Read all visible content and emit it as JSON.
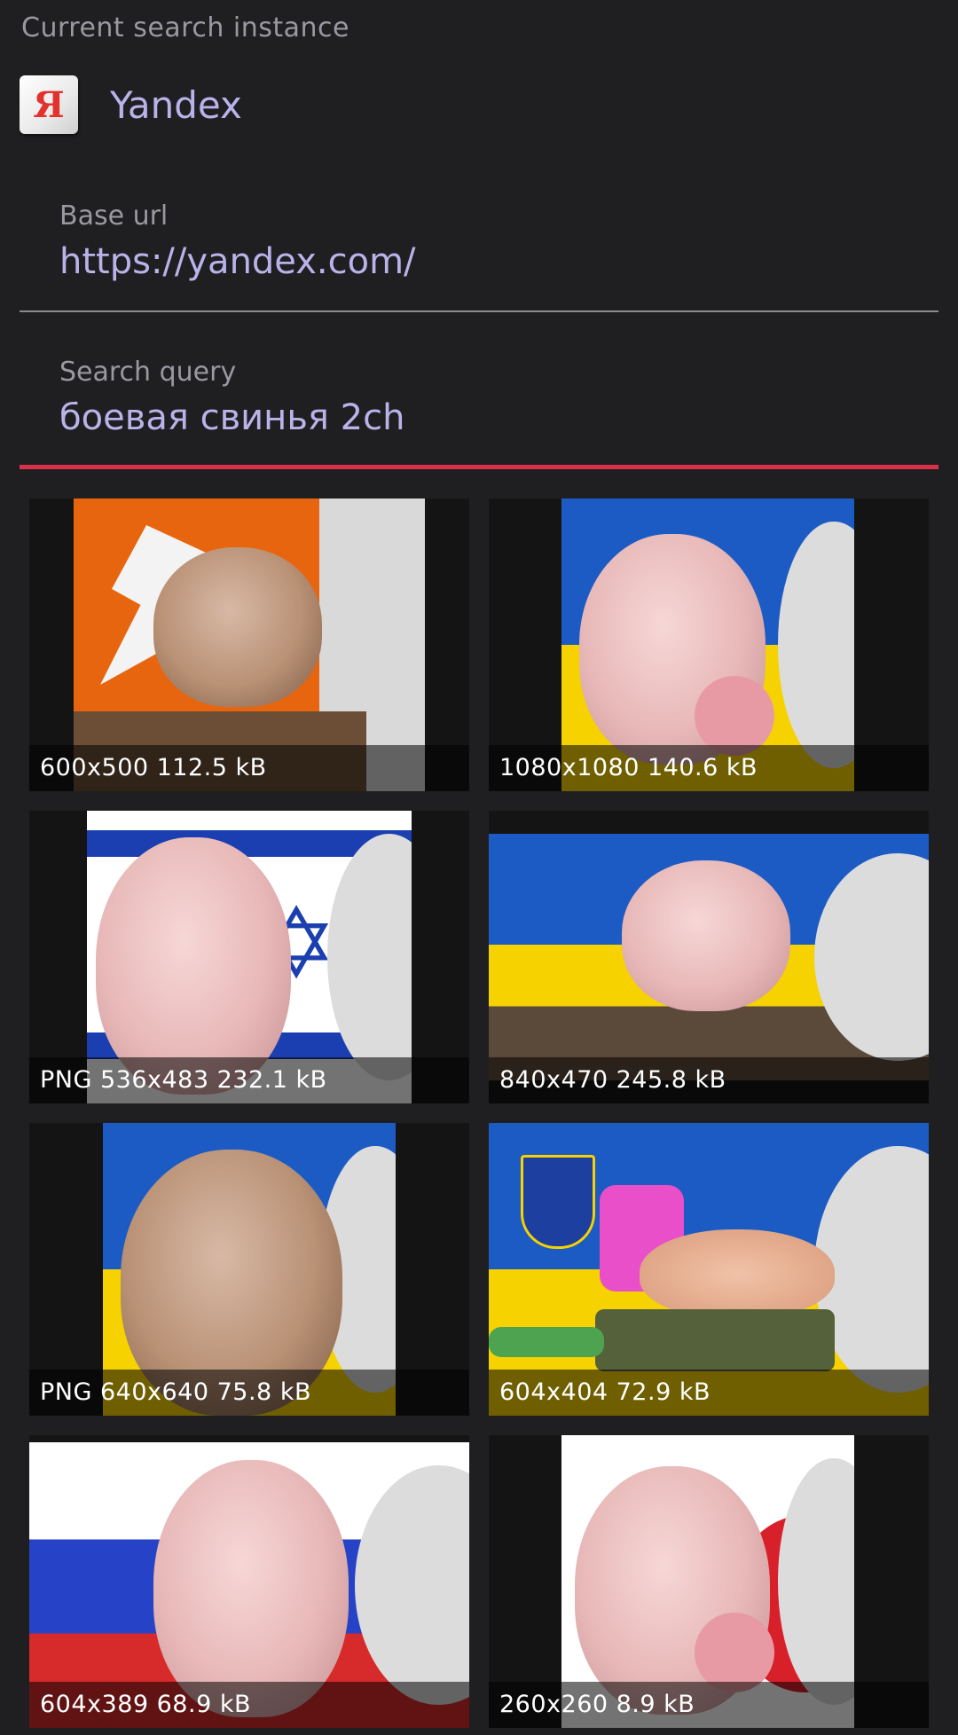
{
  "section": {
    "title": "Current search instance"
  },
  "instance": {
    "name": "Yandex",
    "logo_icon": "yandex-logo-icon",
    "logo_letter": "Я"
  },
  "base_url": {
    "label": "Base url",
    "value": "https://yandex.com/"
  },
  "search_query": {
    "label": "Search query",
    "value": "боевая свинья 2ch"
  },
  "colors": {
    "background": "#1f1f21",
    "accent_text": "#b9b3ea",
    "label_text": "#9a98a0",
    "active_underline": "#d9304a",
    "inactive_underline": "#8a8a8a"
  },
  "results": [
    {
      "caption": "600x500 112.5 kB"
    },
    {
      "caption": "1080x1080 140.6 kB"
    },
    {
      "caption": "PNG 536x483 232.1 kB"
    },
    {
      "caption": "840x470 245.8 kB"
    },
    {
      "caption": "PNG 640x640 75.8 kB"
    },
    {
      "caption": "604x404 72.9 kB"
    },
    {
      "caption": "604x389 68.9 kB"
    },
    {
      "caption": "260x260 8.9 kB"
    }
  ]
}
